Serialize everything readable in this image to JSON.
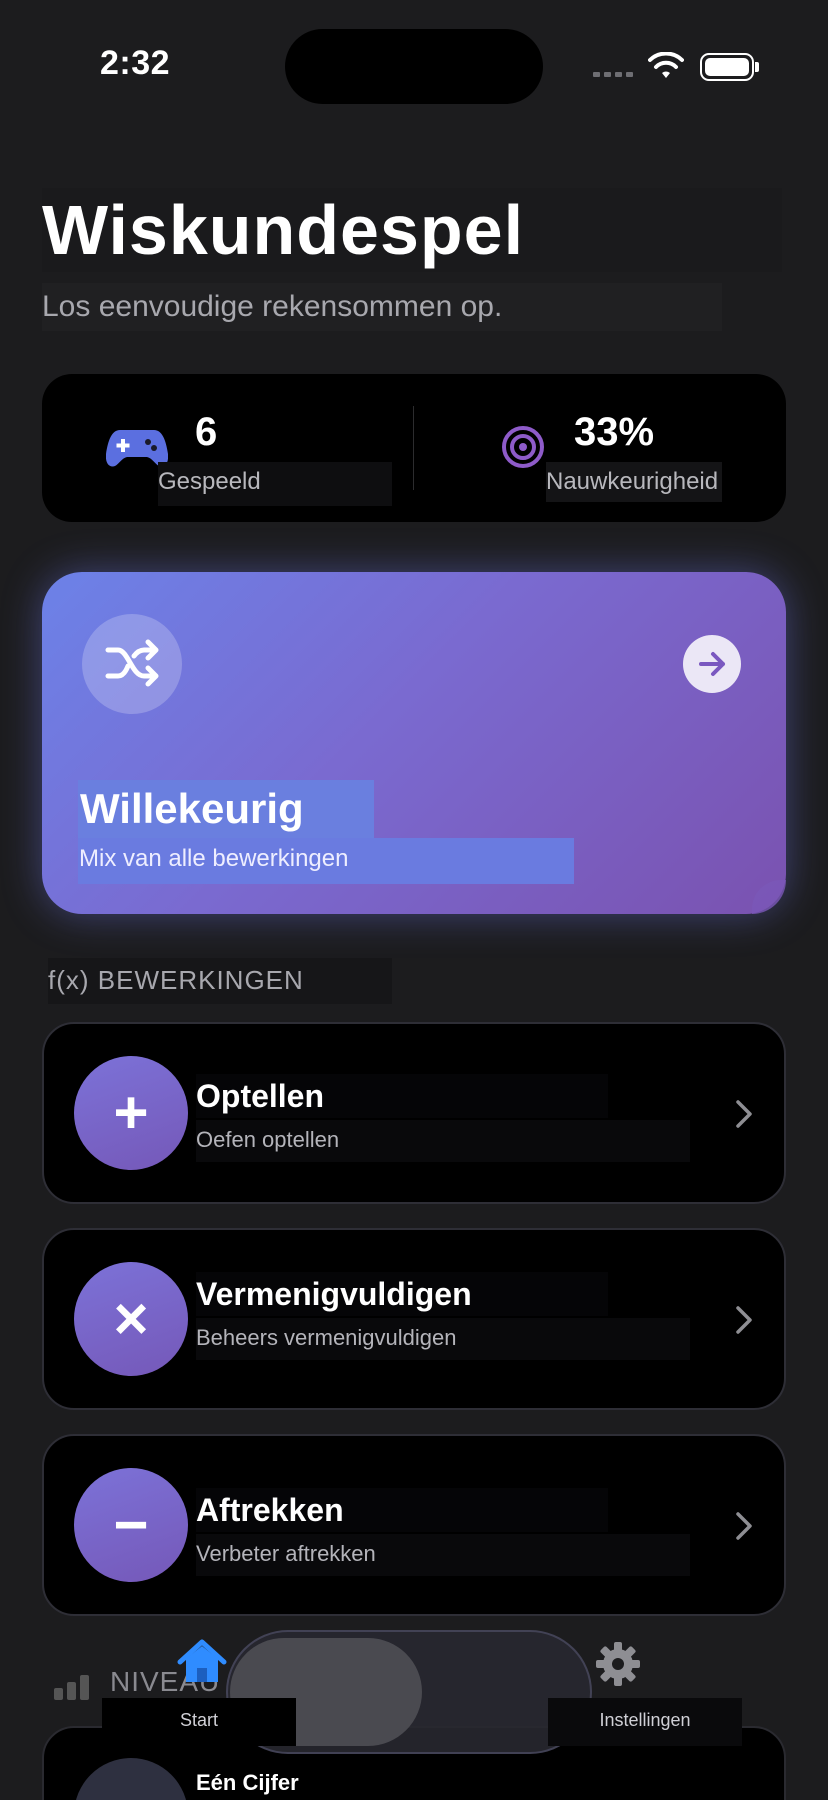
{
  "status_bar": {
    "time": "2:32"
  },
  "header": {
    "title": "Wiskundespel",
    "subtitle": "Los eenvoudige rekensommen op."
  },
  "stats": {
    "played": {
      "value": "6",
      "label": "Gespeeld",
      "icon": "gamecontroller-icon"
    },
    "accuracy": {
      "value": "33%",
      "label": "Nauwkeurigheid",
      "icon": "target-icon"
    }
  },
  "random_card": {
    "title": "Willekeurig",
    "subtitle": "Mix van alle bewerkingen",
    "icon": "shuffle-icon",
    "action_icon": "arrow-right-icon"
  },
  "operations_section": {
    "header": "f(x) BEWERKINGEN",
    "items": [
      {
        "title": "Optellen",
        "subtitle": "Oefen optellen",
        "symbol": "+",
        "icon": "plus-icon"
      },
      {
        "title": "Vermenigvuldigen",
        "subtitle": "Beheers vermenigvuldigen",
        "symbol": "×",
        "icon": "multiply-icon"
      },
      {
        "title": "Aftrekken",
        "subtitle": "Verbeter aftrekken",
        "symbol": "−",
        "icon": "minus-icon"
      }
    ]
  },
  "level_section": {
    "header": "NIVEAU",
    "items": [
      {
        "title": "Eén Cijfer"
      }
    ]
  },
  "tab_bar": {
    "tabs": [
      {
        "label": "Start",
        "icon": "house-icon",
        "selected": true
      },
      {
        "label": "Instellingen",
        "icon": "gear-icon",
        "selected": false
      }
    ]
  },
  "colors": {
    "background": "#1c1c1e",
    "accent_blue": "#2f8cff",
    "accent_purple": "#7558b8",
    "gradient_start": "#6c82e8",
    "gradient_end": "#7a52b0"
  }
}
